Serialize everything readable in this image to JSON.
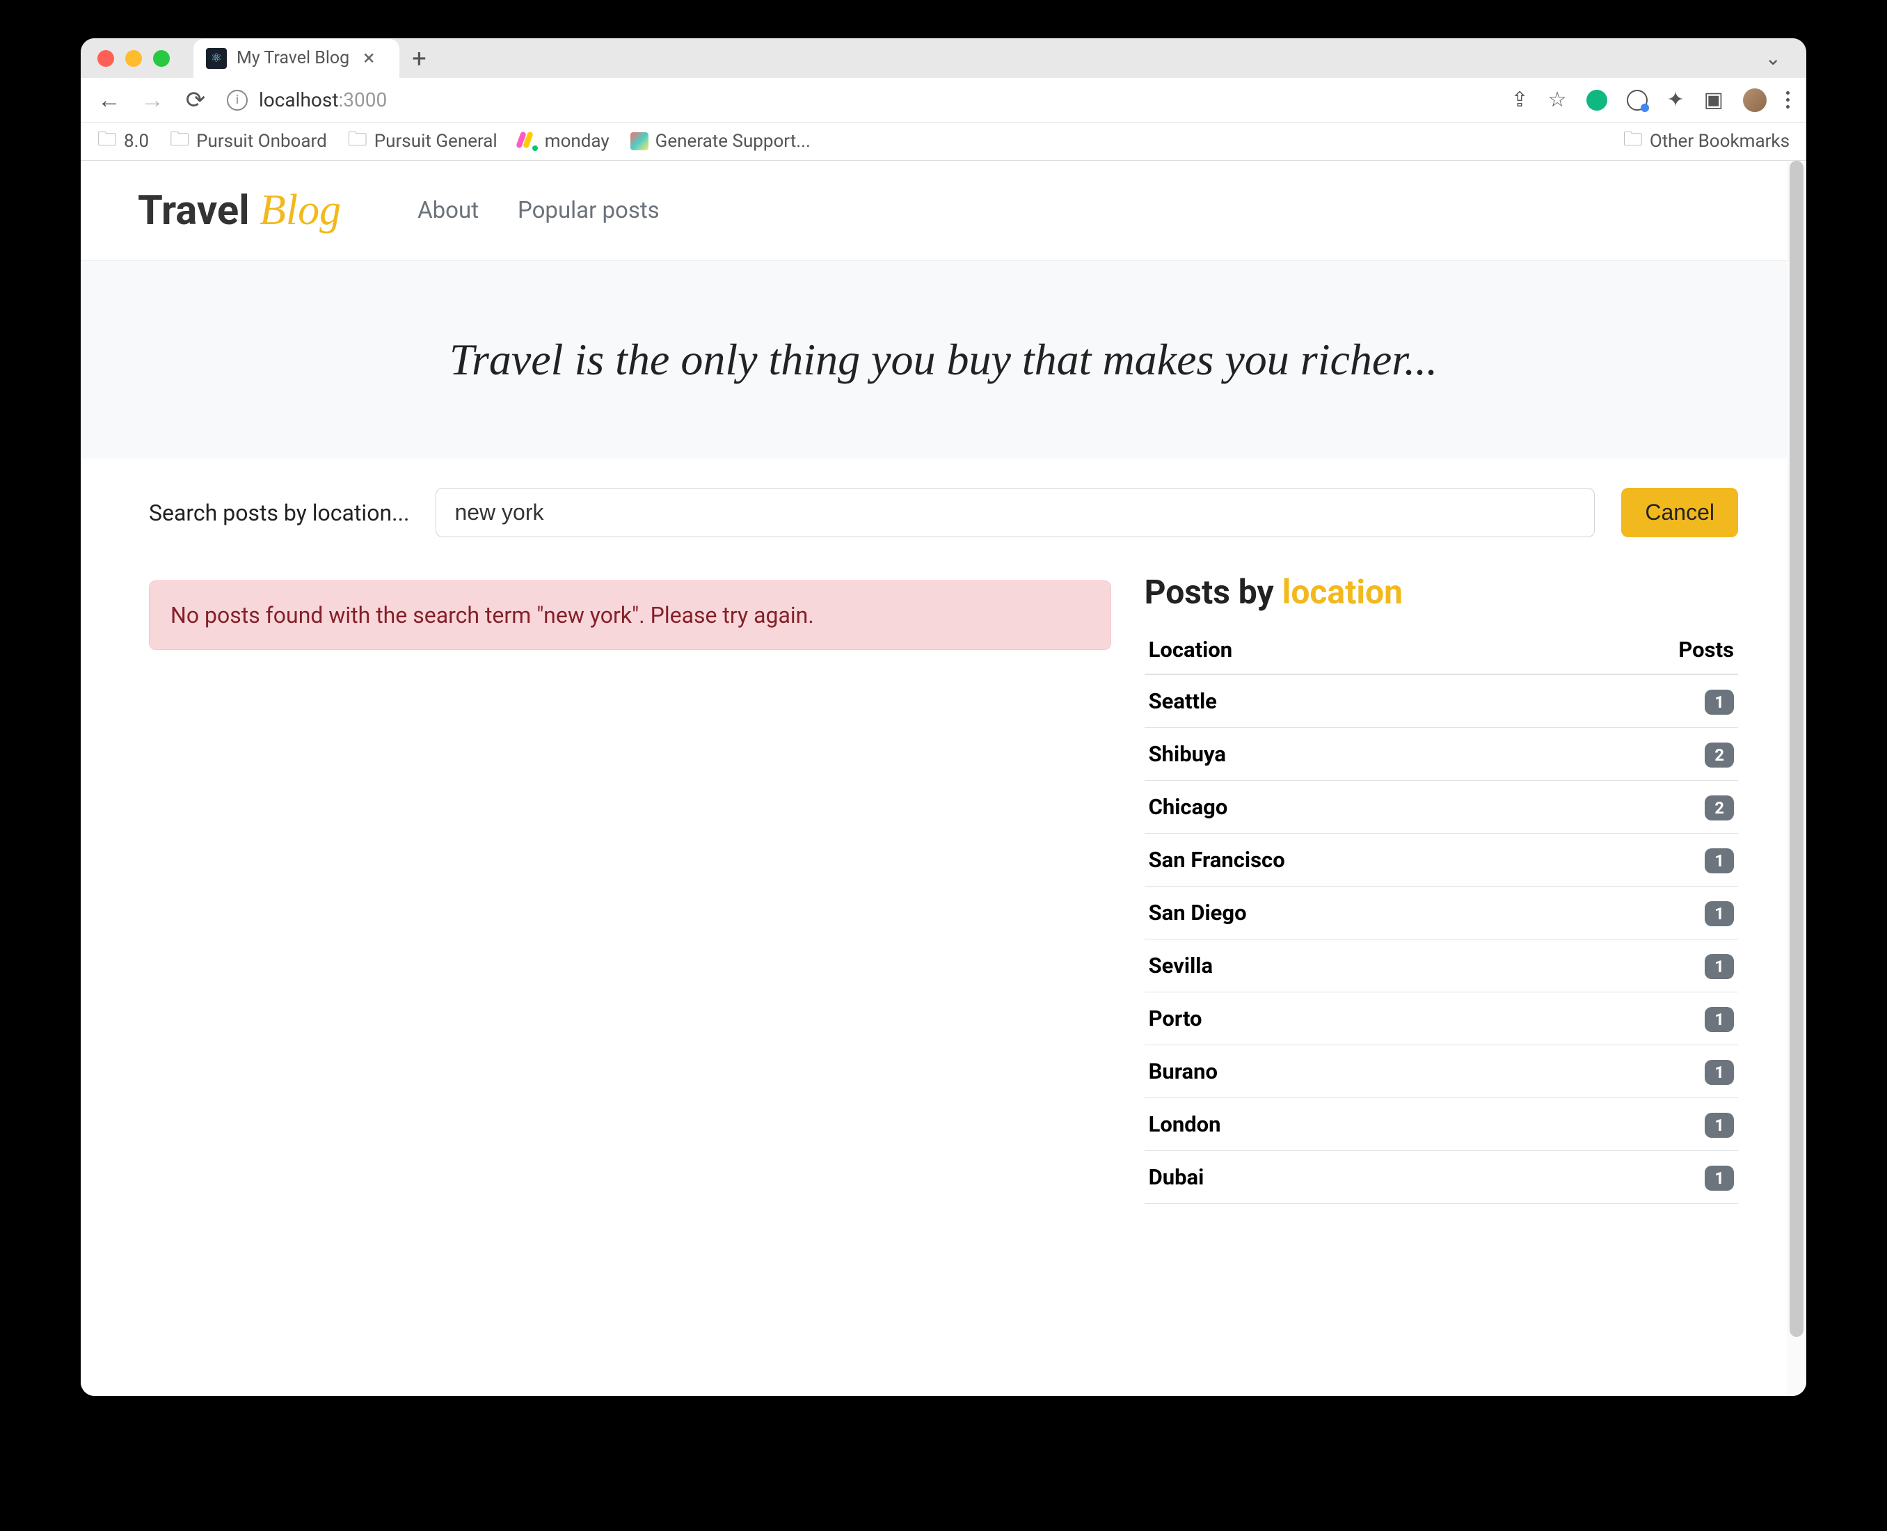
{
  "browser": {
    "tab_title": "My Travel Blog",
    "url_host": "localhost",
    "url_port": ":3000",
    "bookmarks": [
      "8.0",
      "Pursuit Onboard",
      "Pursuit General",
      "monday",
      "Generate Support...",
      "Other Bookmarks"
    ]
  },
  "header": {
    "logo_main": "Travel",
    "logo_script": "Blog",
    "nav": [
      "About",
      "Popular posts"
    ]
  },
  "hero": {
    "quote": "Travel is the only thing you buy that makes you richer..."
  },
  "search": {
    "label": "Search posts by location...",
    "value": "new york",
    "cancel_label": "Cancel"
  },
  "error": {
    "message": "No posts found with the search term \"new york\". Please try again."
  },
  "sidebar": {
    "title_prefix": "Posts by ",
    "title_accent": "location",
    "header_location": "Location",
    "header_posts": "Posts",
    "rows": [
      {
        "location": "Seattle",
        "count": "1"
      },
      {
        "location": "Shibuya",
        "count": "2"
      },
      {
        "location": "Chicago",
        "count": "2"
      },
      {
        "location": "San Francisco",
        "count": "1"
      },
      {
        "location": "San Diego",
        "count": "1"
      },
      {
        "location": "Sevilla",
        "count": "1"
      },
      {
        "location": "Porto",
        "count": "1"
      },
      {
        "location": "Burano",
        "count": "1"
      },
      {
        "location": "London",
        "count": "1"
      },
      {
        "location": "Dubai",
        "count": "1"
      }
    ]
  }
}
